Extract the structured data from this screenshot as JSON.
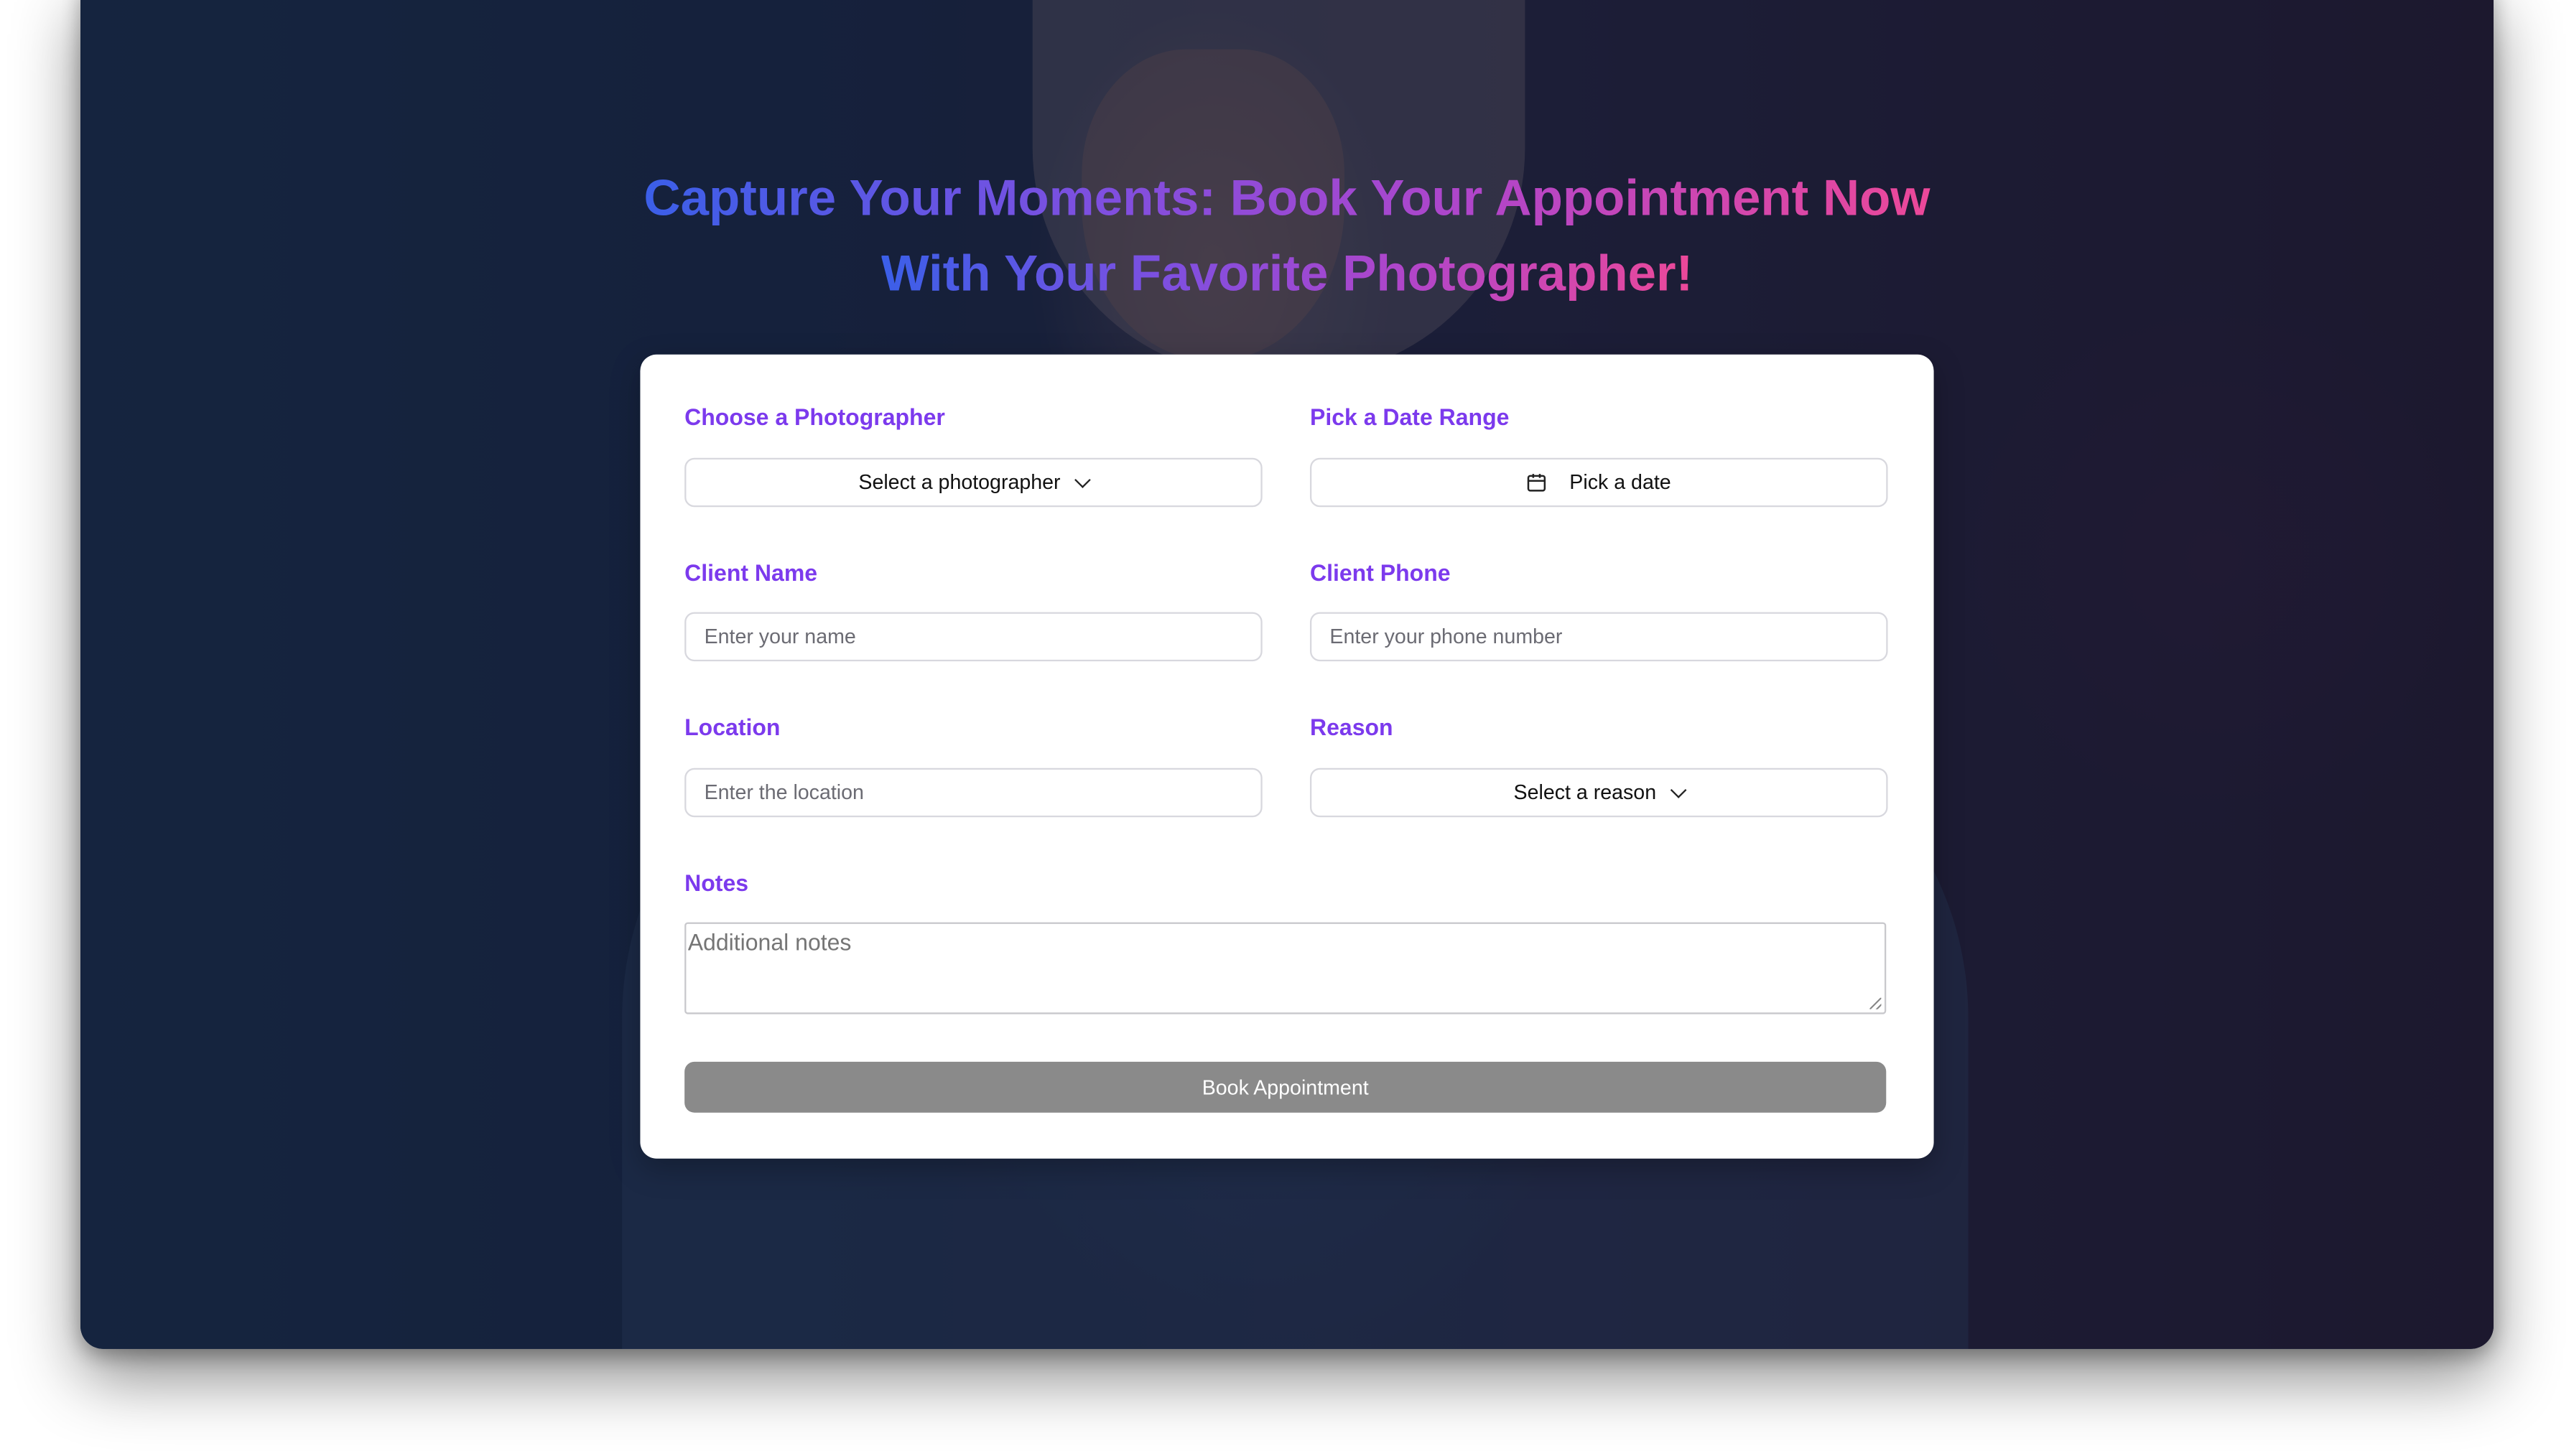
{
  "hero": {
    "title_line1": "Capture Your Moments: Book Your Appointment Now",
    "title_line2": "With Your Favorite Photographer!"
  },
  "form": {
    "photographer": {
      "label": "Choose a Photographer",
      "selected": "Select a photographer",
      "icon": "chevron-down-icon"
    },
    "date_range": {
      "label": "Pick a Date Range",
      "button": "Pick a date",
      "icon": "calendar-icon"
    },
    "client_name": {
      "label": "Client Name",
      "placeholder": "Enter your name"
    },
    "client_phone": {
      "label": "Client Phone",
      "placeholder": "Enter your phone number"
    },
    "location": {
      "label": "Location",
      "placeholder": "Enter the location"
    },
    "reason": {
      "label": "Reason",
      "selected": "Select a reason",
      "icon": "chevron-down-icon"
    },
    "notes": {
      "label": "Notes",
      "placeholder": "Additional notes"
    },
    "submit_label": "Book Appointment"
  },
  "colors": {
    "label": "#7c3aed",
    "title_gradient_start": "#3b5fe8",
    "title_gradient_end": "#ec4899",
    "submit_bg": "#8a8a8a"
  }
}
